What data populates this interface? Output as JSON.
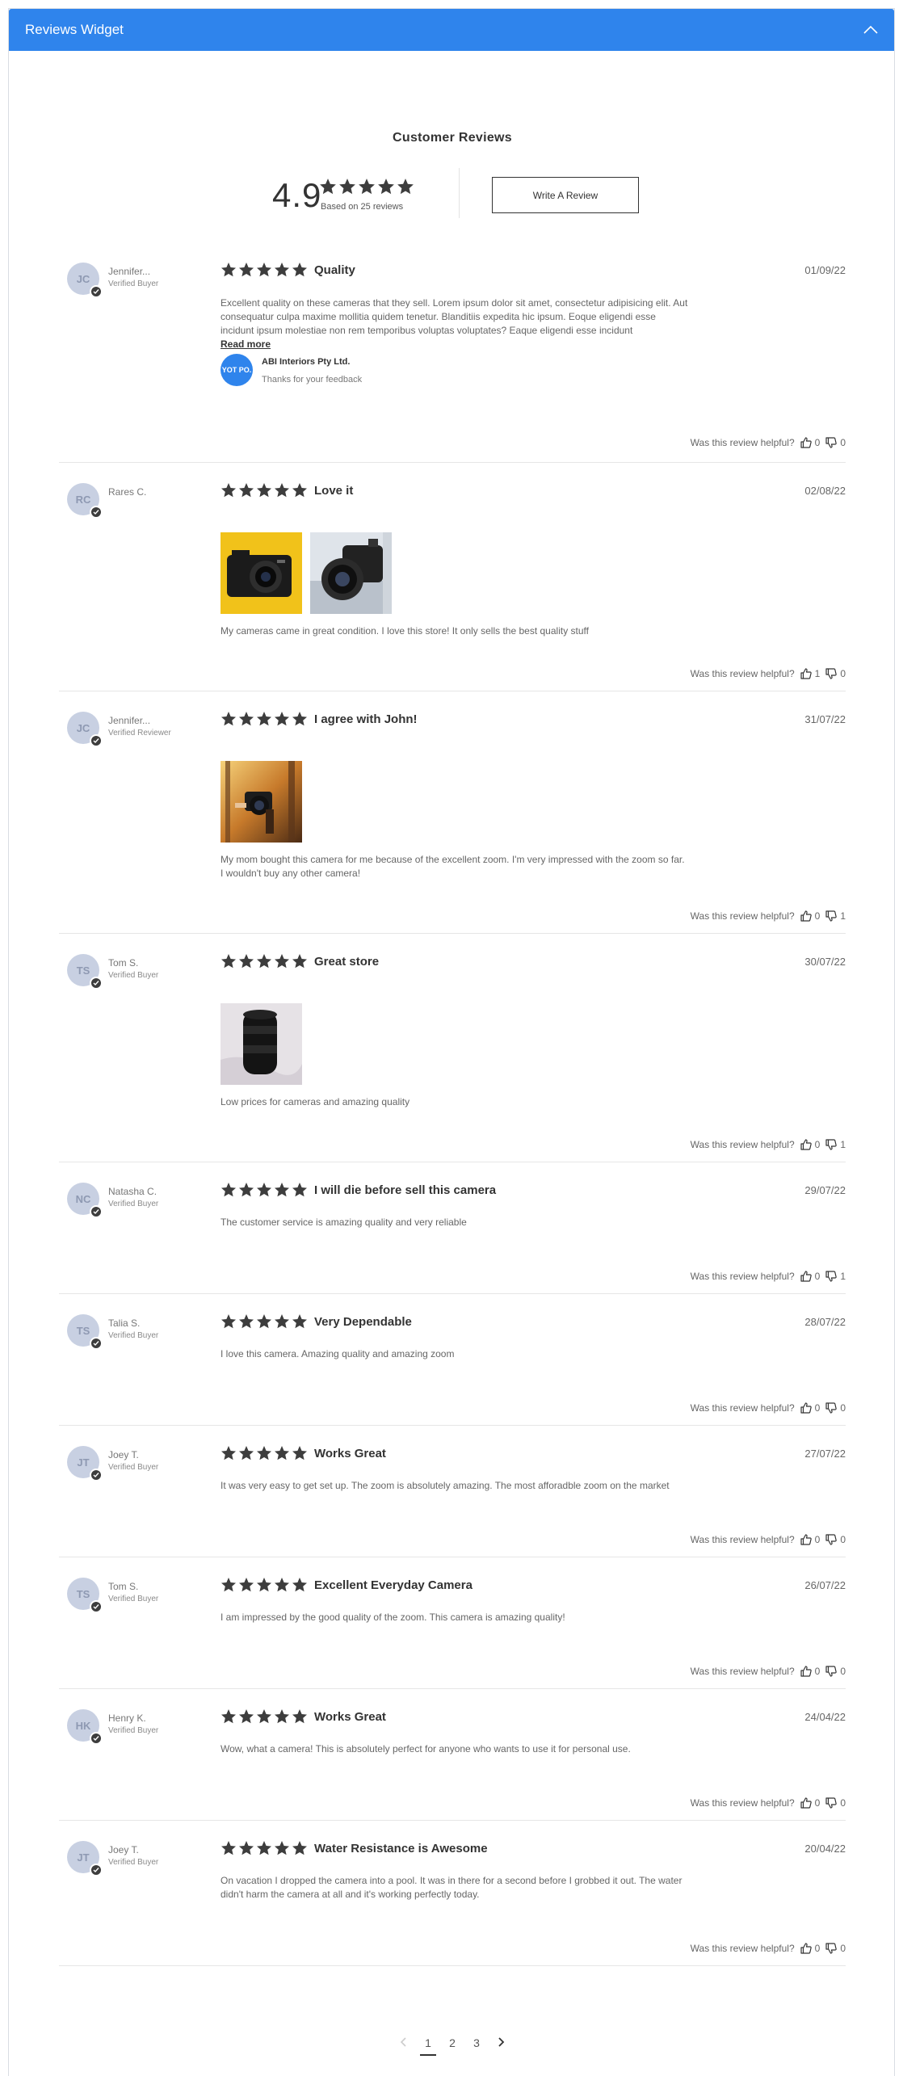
{
  "widget": {
    "title": "Reviews Widget",
    "accent": "#2f84ec"
  },
  "summary": {
    "heading": "Customer Reviews",
    "average": "4.9",
    "rating_fraction": 0.98,
    "count_text": "Based on 25 reviews",
    "write_button": "Write A Review"
  },
  "helpful_label": "Was this review helpful?",
  "reviews": [
    {
      "initials": "JC",
      "author": "Jennifer...",
      "badge": "Verified Buyer",
      "title": "Quality",
      "date": "01/09/22",
      "body": "Excellent quality on these cameras that they sell. Lorem ipsum dolor sit amet, consectetur adipisicing elit. Aut consequatur culpa maxime mollitia quidem tenetur. Blanditiis expedita hic ipsum. Eoque eligendi esse incidunt ipsum molestiae non rem temporibus voluptas voluptates?  Eaque eligendi esse incidunt",
      "read_more": "Read more",
      "reply": {
        "logo": "YOT PO.",
        "name": "ABI Interiors Pty Ltd.",
        "text": "Thanks for your feedback"
      },
      "up": "0",
      "down": "0"
    },
    {
      "initials": "RC",
      "author": "Rares C.",
      "badge": "",
      "title": "Love it",
      "date": "02/08/22",
      "body": "My cameras came in great condition. I love this store! It only sells the best quality stuff",
      "up": "1",
      "down": "0"
    },
    {
      "initials": "JC",
      "author": "Jennifer...",
      "badge": "Verified Reviewer",
      "title": "I agree with John!",
      "date": "31/07/22",
      "body": "My mom bought this camera for me because of the excellent zoom. I'm very impressed with the zoom so far. I wouldn't buy any other camera!",
      "up": "0",
      "down": "1"
    },
    {
      "initials": "TS",
      "author": "Tom S.",
      "badge": "Verified Buyer",
      "title": "Great store",
      "date": "30/07/22",
      "body": "Low prices for cameras and amazing quality",
      "up": "0",
      "down": "1"
    },
    {
      "initials": "NC",
      "author": "Natasha C.",
      "badge": "Verified Buyer",
      "title": "I will die before sell this camera",
      "date": "29/07/22",
      "body": "The customer service is amazing quality and very reliable",
      "up": "0",
      "down": "1"
    },
    {
      "initials": "TS",
      "author": "Talia S.",
      "badge": "Verified Buyer",
      "title": "Very Dependable",
      "date": "28/07/22",
      "body": "I love this camera. Amazing quality and amazing zoom",
      "up": "0",
      "down": "0"
    },
    {
      "initials": "JT",
      "author": "Joey T.",
      "badge": "Verified Buyer",
      "title": "Works Great",
      "date": "27/07/22",
      "body": "It was very easy to get set up. The zoom is absolutely amazing. The most afforadble zoom on the market",
      "up": "0",
      "down": "0"
    },
    {
      "initials": "TS",
      "author": "Tom S.",
      "badge": "Verified Buyer",
      "title": "Excellent Everyday Camera",
      "date": "26/07/22",
      "body": "I am impressed by the good quality of the zoom. This camera is amazing quality!",
      "up": "0",
      "down": "0"
    },
    {
      "initials": "HK",
      "author": "Henry K.",
      "badge": "Verified Buyer",
      "title": "Works Great",
      "date": "24/04/22",
      "body": "Wow, what a camera! This is absolutely perfect for anyone who wants to use it for personal use.",
      "up": "0",
      "down": "0"
    },
    {
      "initials": "JT",
      "author": "Joey T.",
      "badge": "Verified Buyer",
      "title": "Water Resistance is Awesome",
      "date": "20/04/22",
      "body": "On vacation I dropped the camera into a pool. It was in there for a second before I grobbed it out. The water didn't harm the camera at all and it's working perfectly today.",
      "up": "0",
      "down": "0"
    }
  ],
  "pagination": {
    "pages": [
      "1",
      "2",
      "3"
    ],
    "current": "1",
    "prev": "‹",
    "next": "›"
  }
}
